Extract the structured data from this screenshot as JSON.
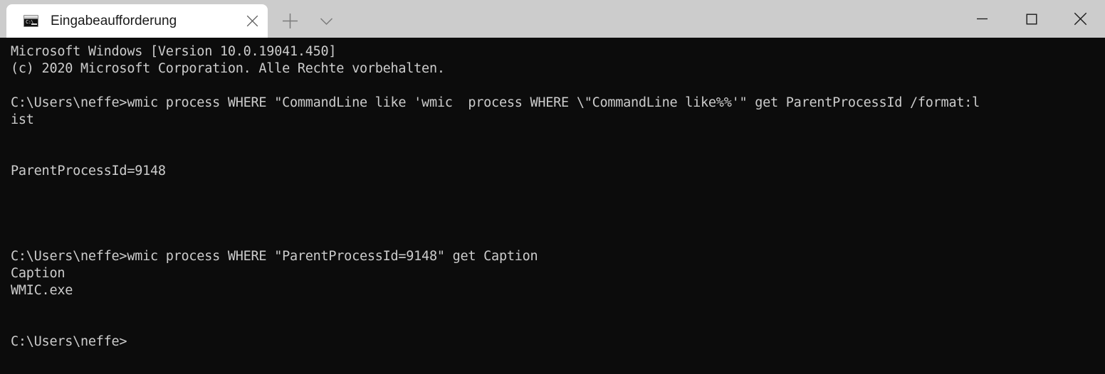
{
  "window": {
    "titlebar_color": "#cccccc",
    "tab_active_color": "#ffffff",
    "console_bg": "#0c0c0c",
    "console_fg": "#cccccc"
  },
  "tabs": [
    {
      "label": "Eingabeaufforderung",
      "icon": "command-prompt-icon",
      "icon_prompt_text": "C:\\",
      "close_label": "✕",
      "active": true
    }
  ],
  "tabbar": {
    "new_tab_label": "+",
    "dropdown_label": "⌄"
  },
  "window_controls": {
    "minimize_label": "—",
    "maximize_label": "□",
    "close_label": "✕"
  },
  "console": {
    "lines": [
      "Microsoft Windows [Version 10.0.19041.450]",
      "(c) 2020 Microsoft Corporation. Alle Rechte vorbehalten.",
      "",
      "C:\\Users\\neffe>wmic process WHERE \"CommandLine like 'wmic  process WHERE \\\"CommandLine like%%'\" get ParentProcessId /format:l",
      "ist",
      "",
      "",
      "ParentProcessId=9148",
      "",
      "",
      "",
      "",
      "C:\\Users\\neffe>wmic process WHERE \"ParentProcessId=9148\" get Caption",
      "Caption",
      "WMIC.exe",
      "",
      "",
      "C:\\Users\\neffe>"
    ]
  }
}
